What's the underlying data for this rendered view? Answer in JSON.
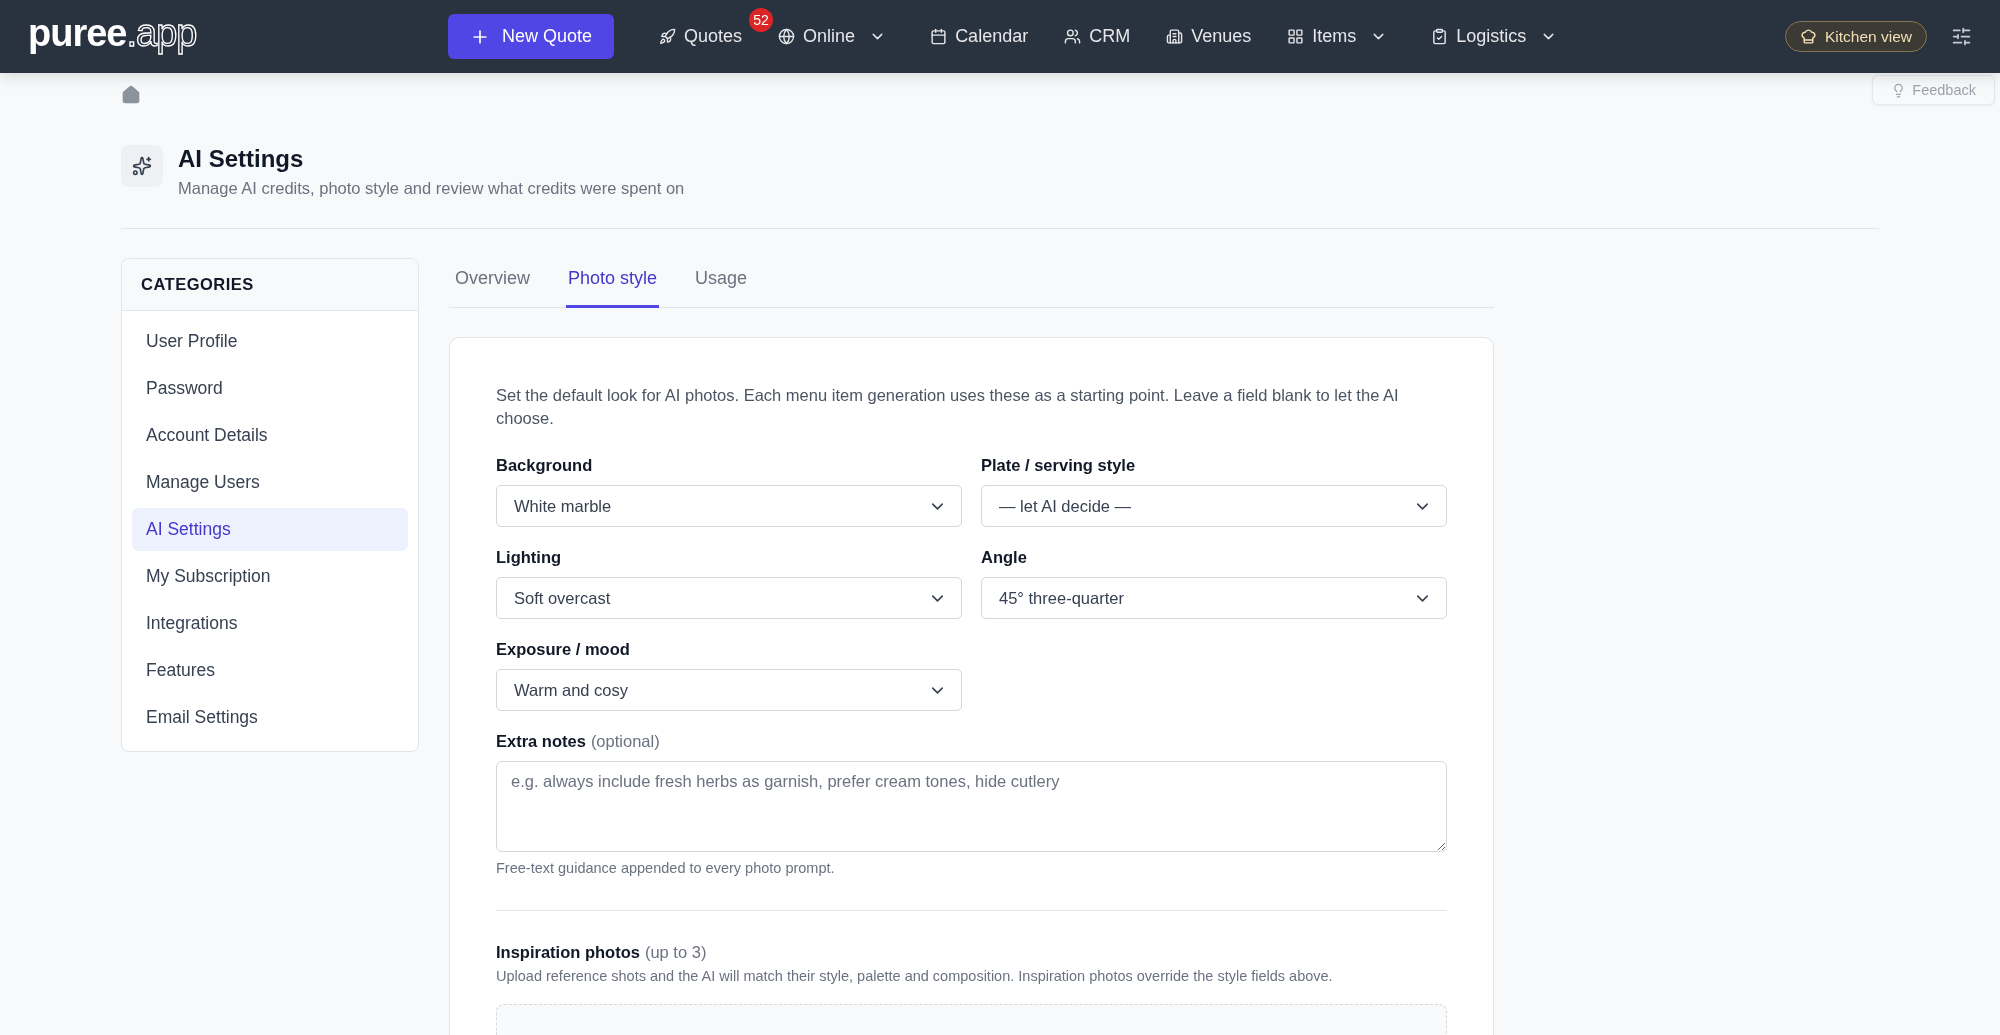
{
  "nav": {
    "logo": {
      "name": "puree",
      "suffix": ".app"
    },
    "new_button": "New Quote",
    "items": [
      {
        "label": "Quotes",
        "badge": "52",
        "dropdown": false
      },
      {
        "label": "Online",
        "dropdown": true
      },
      {
        "label": "Calendar",
        "dropdown": false
      },
      {
        "label": "CRM",
        "dropdown": false
      },
      {
        "label": "Venues",
        "dropdown": false
      },
      {
        "label": "Items",
        "dropdown": true
      },
      {
        "label": "Logistics",
        "dropdown": true
      }
    ],
    "kitchen_button": "Kitchen view"
  },
  "feedback": "Feedback",
  "header": {
    "title": "AI Settings",
    "subtitle": "Manage AI credits, photo style and review what credits were spent on"
  },
  "sidebar": {
    "heading": "CATEGORIES",
    "items": [
      {
        "label": "User Profile",
        "selected": false
      },
      {
        "label": "Password",
        "selected": false
      },
      {
        "label": "Account Details",
        "selected": false
      },
      {
        "label": "Manage Users",
        "selected": false
      },
      {
        "label": "AI Settings",
        "selected": true
      },
      {
        "label": "My Subscription",
        "selected": false
      },
      {
        "label": "Integrations",
        "selected": false
      },
      {
        "label": "Features",
        "selected": false
      },
      {
        "label": "Email Settings",
        "selected": false
      }
    ]
  },
  "tabs": [
    {
      "label": "Overview",
      "selected": false
    },
    {
      "label": "Photo style",
      "selected": true
    },
    {
      "label": "Usage",
      "selected": false
    }
  ],
  "form": {
    "intro": "Set the default look for AI photos. Each menu item generation uses these as a starting point. Leave a field blank to let the AI choose.",
    "fields": [
      {
        "label": "Background",
        "value": "White marble"
      },
      {
        "label": "Plate / serving style",
        "value": "— let AI decide —"
      },
      {
        "label": "Lighting",
        "value": "Soft overcast"
      },
      {
        "label": "Angle",
        "value": "45° three-quarter"
      },
      {
        "label": "Exposure / mood",
        "value": "Warm and cosy"
      }
    ],
    "notes": {
      "label": "Extra notes",
      "optional": "(optional)",
      "placeholder": "e.g. always include fresh herbs as garnish, prefer cream tones, hide cutlery",
      "hint": "Free-text guidance appended to every photo prompt."
    },
    "inspiration": {
      "title": "Inspiration photos",
      "note": "(up to 3)",
      "description": "Upload reference shots and the AI will match their style, palette and composition. Inspiration photos override the style fields above."
    }
  }
}
